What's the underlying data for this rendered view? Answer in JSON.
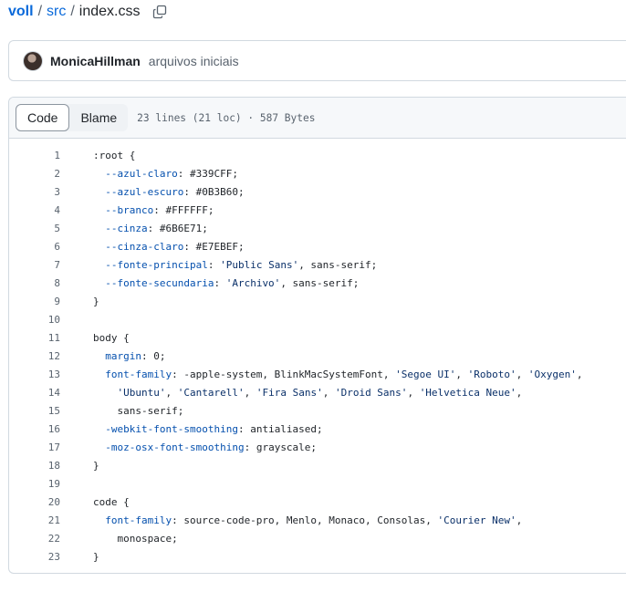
{
  "breadcrumb": {
    "repo": "voll",
    "sep": "/",
    "folder": "src",
    "file": "index.css"
  },
  "commit": {
    "author": "MonicaHillman",
    "message": "arquivos iniciais"
  },
  "file_header": {
    "code_tab": "Code",
    "blame_tab": "Blame",
    "info": "23 lines (21 loc) · 587 Bytes"
  },
  "lines": [
    [
      {
        "t": ":root {",
        "c": "sel"
      }
    ],
    [
      {
        "t": "  --azul-claro",
        "c": "prop"
      },
      {
        "t": ": #339CFF;",
        "c": "val"
      }
    ],
    [
      {
        "t": "  --azul-escuro",
        "c": "prop"
      },
      {
        "t": ": #0B3B60;",
        "c": "val"
      }
    ],
    [
      {
        "t": "  --branco",
        "c": "prop"
      },
      {
        "t": ": #FFFFFF;",
        "c": "val"
      }
    ],
    [
      {
        "t": "  --cinza",
        "c": "prop"
      },
      {
        "t": ": #6B6E71;",
        "c": "val"
      }
    ],
    [
      {
        "t": "  --cinza-claro",
        "c": "prop"
      },
      {
        "t": ": #E7EBEF;",
        "c": "val"
      }
    ],
    [
      {
        "t": "  --fonte-principal",
        "c": "prop"
      },
      {
        "t": ": ",
        "c": "val"
      },
      {
        "t": "'Public Sans'",
        "c": "str"
      },
      {
        "t": ", sans-serif;",
        "c": "val"
      }
    ],
    [
      {
        "t": "  --fonte-secundaria",
        "c": "prop"
      },
      {
        "t": ": ",
        "c": "val"
      },
      {
        "t": "'Archivo'",
        "c": "str"
      },
      {
        "t": ", sans-serif;",
        "c": "val"
      }
    ],
    [
      {
        "t": "}",
        "c": "sel"
      }
    ],
    [],
    [
      {
        "t": "body {",
        "c": "sel"
      }
    ],
    [
      {
        "t": "  margin",
        "c": "prop"
      },
      {
        "t": ": 0;",
        "c": "val"
      }
    ],
    [
      {
        "t": "  font-family",
        "c": "prop"
      },
      {
        "t": ": -apple-system, BlinkMacSystemFont, ",
        "c": "val"
      },
      {
        "t": "'Segoe UI'",
        "c": "str"
      },
      {
        "t": ", ",
        "c": "val"
      },
      {
        "t": "'Roboto'",
        "c": "str"
      },
      {
        "t": ", ",
        "c": "val"
      },
      {
        "t": "'Oxygen'",
        "c": "str"
      },
      {
        "t": ",",
        "c": "val"
      }
    ],
    [
      {
        "t": "    ",
        "c": "val"
      },
      {
        "t": "'Ubuntu'",
        "c": "str"
      },
      {
        "t": ", ",
        "c": "val"
      },
      {
        "t": "'Cantarell'",
        "c": "str"
      },
      {
        "t": ", ",
        "c": "val"
      },
      {
        "t": "'Fira Sans'",
        "c": "str"
      },
      {
        "t": ", ",
        "c": "val"
      },
      {
        "t": "'Droid Sans'",
        "c": "str"
      },
      {
        "t": ", ",
        "c": "val"
      },
      {
        "t": "'Helvetica Neue'",
        "c": "str"
      },
      {
        "t": ",",
        "c": "val"
      }
    ],
    [
      {
        "t": "    sans-serif;",
        "c": "val"
      }
    ],
    [
      {
        "t": "  -webkit-font-smoothing",
        "c": "prop"
      },
      {
        "t": ": antialiased;",
        "c": "val"
      }
    ],
    [
      {
        "t": "  -moz-osx-font-smoothing",
        "c": "prop"
      },
      {
        "t": ": grayscale;",
        "c": "val"
      }
    ],
    [
      {
        "t": "}",
        "c": "sel"
      }
    ],
    [],
    [
      {
        "t": "code {",
        "c": "sel"
      }
    ],
    [
      {
        "t": "  font-family",
        "c": "prop"
      },
      {
        "t": ": source-code-pro, Menlo, Monaco, Consolas, ",
        "c": "val"
      },
      {
        "t": "'Courier New'",
        "c": "str"
      },
      {
        "t": ",",
        "c": "val"
      }
    ],
    [
      {
        "t": "    monospace;",
        "c": "val"
      }
    ],
    [
      {
        "t": "}",
        "c": "sel"
      }
    ]
  ]
}
